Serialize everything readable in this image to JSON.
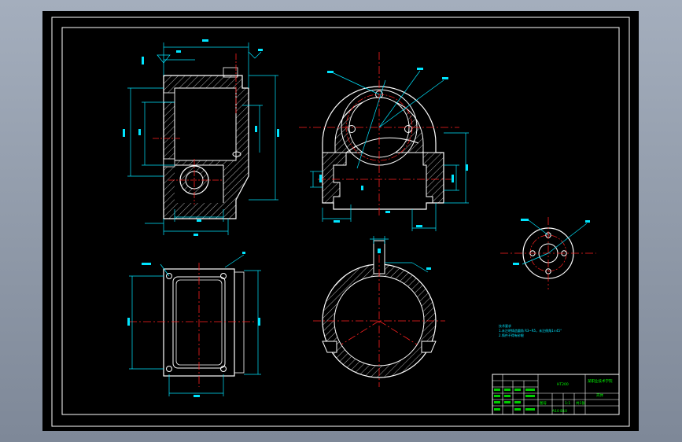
{
  "drawing": {
    "title": "",
    "notes": {
      "heading": "技术要求",
      "line1": "1.未注明铸造圆角 R3~R5，未注倒角1×45°",
      "line2": "2.铸件不得有砂眼"
    },
    "title_block": {
      "part_name": "壳体",
      "school": "某职业技术学院",
      "drawing_no": "图号",
      "material": "HT200",
      "scale": "1:1",
      "sheet": "共1张",
      "footer": "A10 B10"
    },
    "colors": {
      "outline": "#ffffff",
      "center_line": "#ff2020",
      "dimension": "#00e5ff",
      "hatch": "#e8e8e8",
      "title_block_text": "#00ff00"
    }
  }
}
